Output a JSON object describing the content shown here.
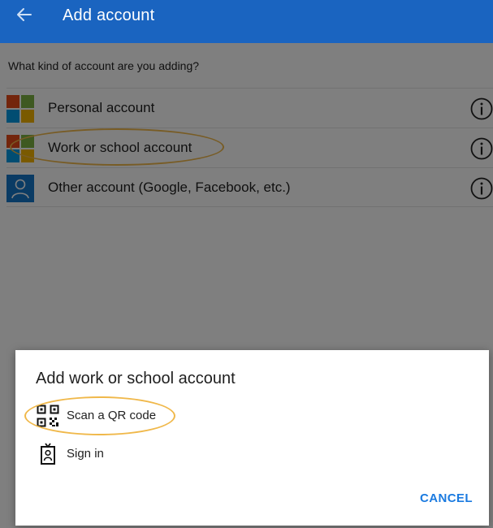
{
  "appbar": {
    "title": "Add account",
    "back_icon": "arrow-left-icon",
    "background": "#1a64c0"
  },
  "main": {
    "prompt": "What kind of account are you adding?",
    "items": [
      {
        "label": "Personal account",
        "icon": "microsoft-logo-icon",
        "info_icon": "info-icon"
      },
      {
        "label": "Work or school account",
        "icon": "microsoft-logo-icon",
        "info_icon": "info-icon",
        "highlighted": true
      },
      {
        "label": "Other account (Google, Facebook, etc.)",
        "icon": "person-icon",
        "info_icon": "info-icon"
      }
    ]
  },
  "dialog": {
    "title": "Add work or school account",
    "options": [
      {
        "label": "Scan a QR code",
        "icon": "qr-code-icon",
        "highlighted": true
      },
      {
        "label": "Sign in",
        "icon": "id-badge-icon"
      }
    ],
    "cancel_label": "CANCEL"
  },
  "colors": {
    "accent": "#1a7ae0",
    "highlight": "#f0b84a",
    "ms_red": "#e64a19",
    "ms_green": "#7cb342",
    "ms_blue": "#039be5",
    "ms_yellow": "#f4b400"
  }
}
